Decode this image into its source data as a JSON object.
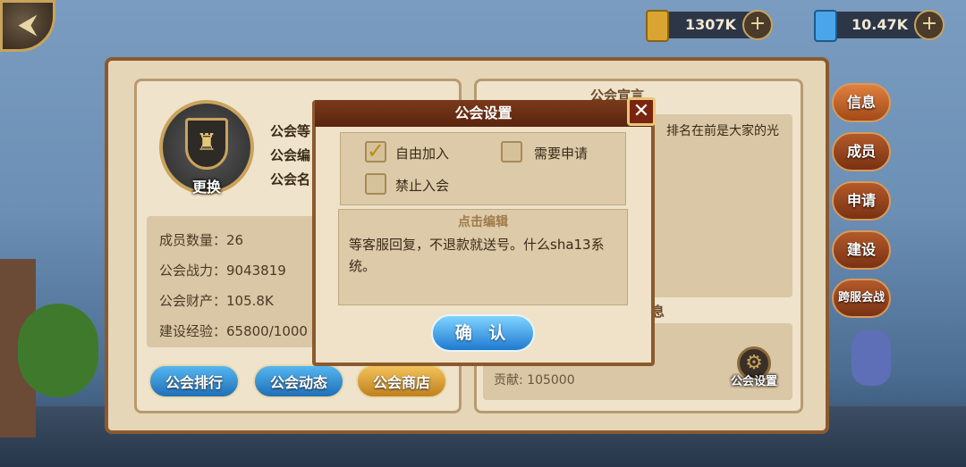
{
  "resources": {
    "gold": {
      "value": "1307K",
      "icon": "gold-bar-icon",
      "color": "#d9a431"
    },
    "gems": {
      "value": "10.47K",
      "icon": "crystal-card-icon",
      "color": "#4aa6e8"
    }
  },
  "guild": {
    "emblem_label": "更换",
    "info_labels": [
      "公会等",
      "公会编",
      "公会名"
    ],
    "stats": [
      {
        "label": "成员数量：26"
      },
      {
        "label": "公会战力：9043819"
      },
      {
        "label": "公会财产：105.8K"
      },
      {
        "label": "建设经验：65800/1000"
      }
    ],
    "buttons": {
      "rank": "公会排行",
      "news": "公会动态",
      "shop": "公会商店"
    }
  },
  "right_panel": {
    "announce_title": "公会宣言",
    "announce_text": "排名在前是大家的光",
    "member_title": "息",
    "contribution": "贡献: 105000",
    "settings_label": "公会设置"
  },
  "side_tabs": [
    "信息",
    "成员",
    "申请",
    "建设",
    "跨服会战"
  ],
  "dialog": {
    "title": "公会设置",
    "close": "✕",
    "options": [
      {
        "label": "自由加入",
        "checked": true
      },
      {
        "label": "需要申请",
        "checked": false
      },
      {
        "label": "禁止入会",
        "checked": false
      }
    ],
    "edit_title": "点击编辑",
    "edit_text": "等客服回复，不退款就送号。什么sha13系统。",
    "confirm": "确 认"
  },
  "colors": {
    "accent_gold": "#c9a35c",
    "panel": "#e6d6b8",
    "button_blue": "#1f7ad0",
    "button_gold": "#c0801e"
  }
}
